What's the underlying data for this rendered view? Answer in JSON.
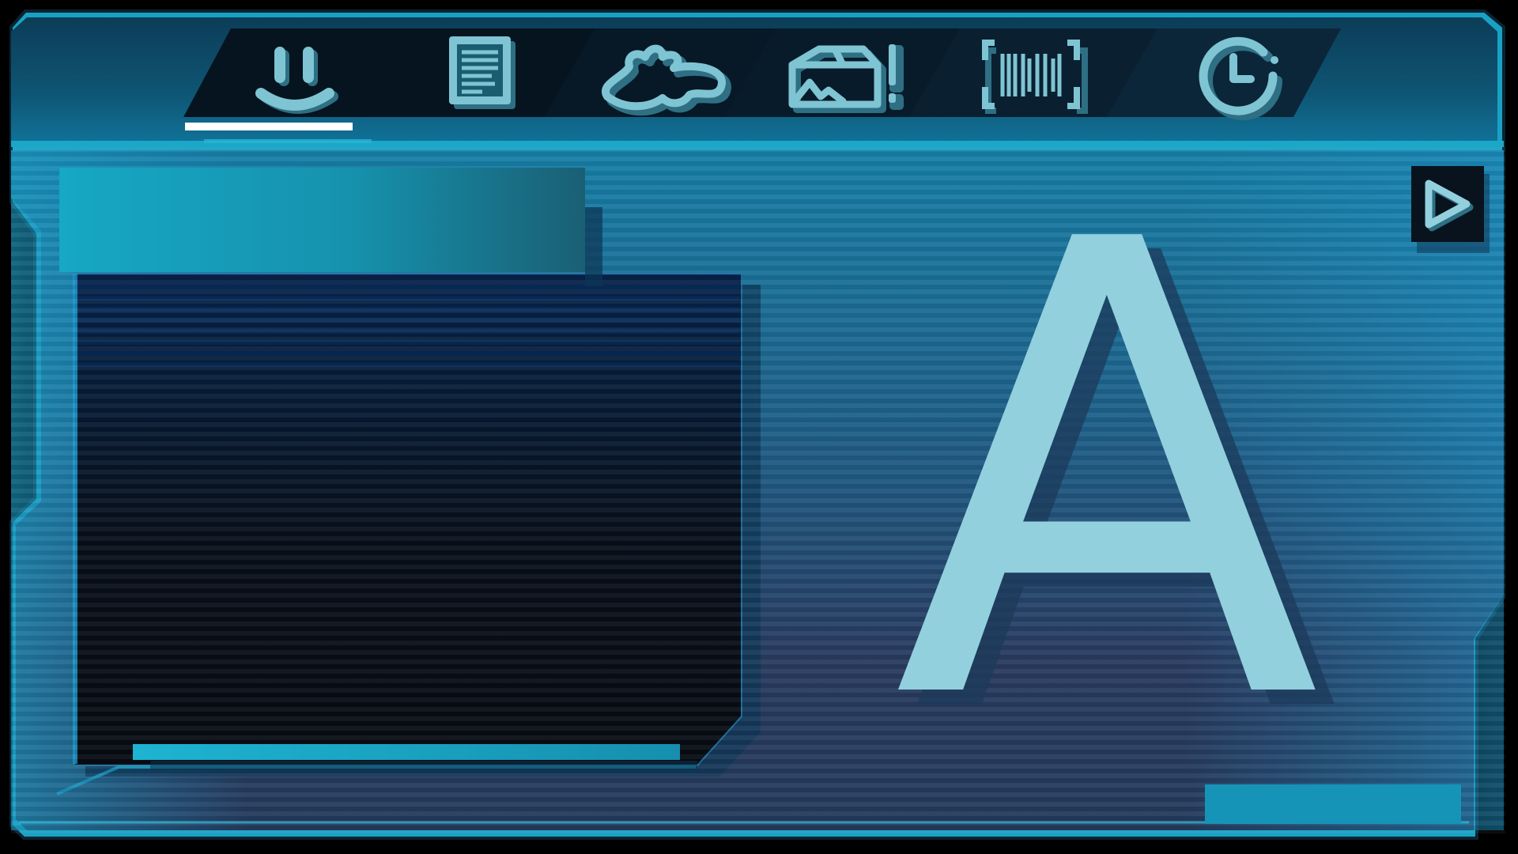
{
  "window": {
    "frame_color": "#1596b6",
    "frame_edge_color": "#29b3d1",
    "panel_top_color": "#157aa1",
    "panel_bottom_color": "#283a5e",
    "tab_bar_color": "#0a2233"
  },
  "tabs": [
    {
      "id": "tab-smile",
      "icon": "smile-icon",
      "selected": true
    },
    {
      "id": "tab-document",
      "icon": "document-icon",
      "selected": false
    },
    {
      "id": "tab-splat",
      "icon": "splat-icon",
      "selected": false
    },
    {
      "id": "tab-box-alert",
      "icon": "box-alert-icon",
      "selected": false
    },
    {
      "id": "tab-barcode",
      "icon": "barcode-scan-icon",
      "selected": false
    },
    {
      "id": "tab-clock",
      "icon": "clock-icon",
      "selected": false
    }
  ],
  "accent": {
    "icon_color": "#7fc4d3",
    "icon_shadow": "#2e6f83",
    "tab_underline": "#ffffff",
    "glyph_color": "#92d0de"
  },
  "preview": {
    "progress_fraction": 1.0
  },
  "glyph": {
    "character": "A"
  },
  "next": {
    "icon": "play-triangle-icon"
  }
}
